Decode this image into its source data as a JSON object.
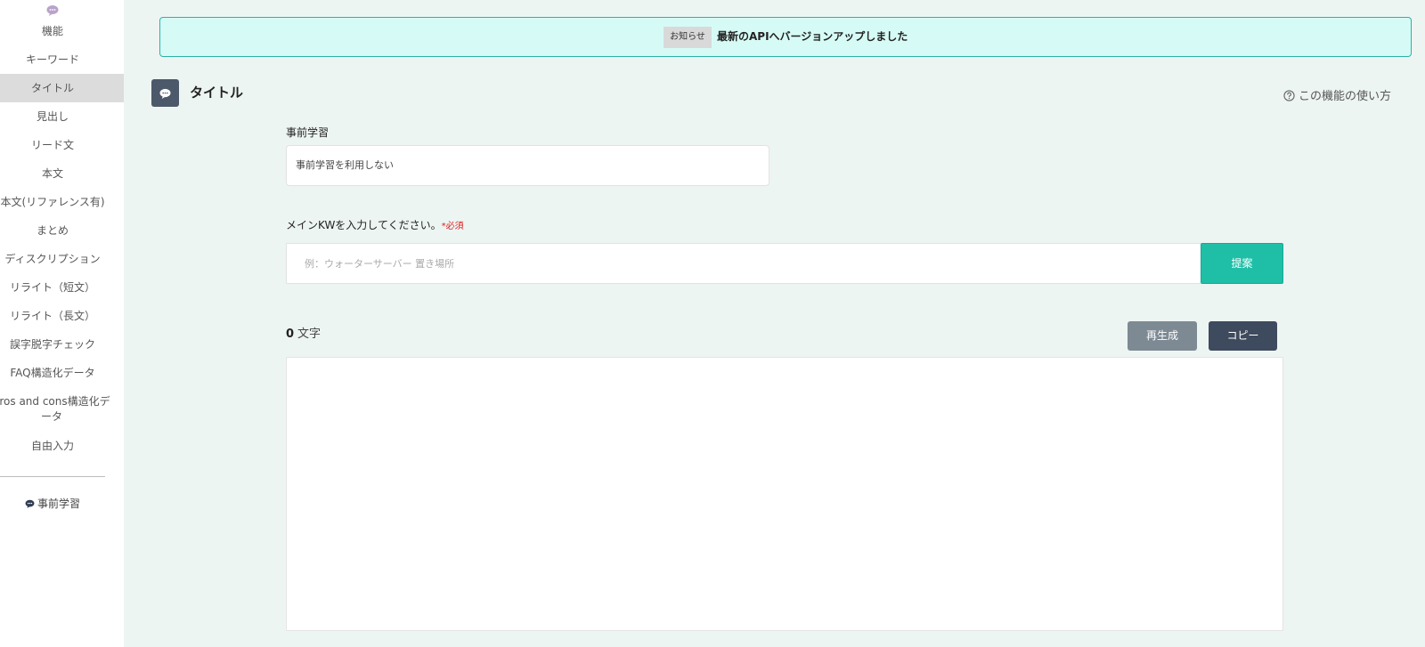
{
  "sidebar": {
    "header": "機能",
    "items": [
      {
        "label": "キーワード",
        "active": false
      },
      {
        "label": "タイトル",
        "active": true
      },
      {
        "label": "見出し",
        "active": false
      },
      {
        "label": "リード文",
        "active": false
      },
      {
        "label": "本文",
        "active": false
      },
      {
        "label": "本文(リファレンス有)",
        "active": false
      },
      {
        "label": "まとめ",
        "active": false
      },
      {
        "label": "ディスクリプション",
        "active": false
      },
      {
        "label": "リライト（短文）",
        "active": false
      },
      {
        "label": "リライト（長文）",
        "active": false
      },
      {
        "label": "誤字脱字チェック",
        "active": false
      },
      {
        "label": "FAQ構造化データ",
        "active": false
      },
      {
        "label": "Pros and cons構造化データ",
        "active": false
      },
      {
        "label": "自由入力",
        "active": false
      }
    ],
    "pretrain_link": "事前学習"
  },
  "notice": {
    "badge": "お知らせ",
    "message": "最新のAPIへバージョンアップしました"
  },
  "page": {
    "title": "タイトル",
    "help_link": "この機能の使い方"
  },
  "form": {
    "pretrain_label": "事前学習",
    "pretrain_value": "事前学習を利用しない",
    "kw_label": "メインKWを入力してください。",
    "kw_required": "*必須",
    "kw_placeholder": "例：ウォーターサーバー 置き場所",
    "suggest_button": "提案"
  },
  "output": {
    "char_count": "0",
    "char_unit": "文字",
    "regenerate_button": "再生成",
    "copy_button": "コピー",
    "text": ""
  },
  "colors": {
    "accent": "#1fbfa7",
    "notice_bg": "#d6fbf6",
    "dark_button": "#3e4a5d",
    "gray_button": "#7d8a94",
    "page_bg": "#edf5f3"
  }
}
